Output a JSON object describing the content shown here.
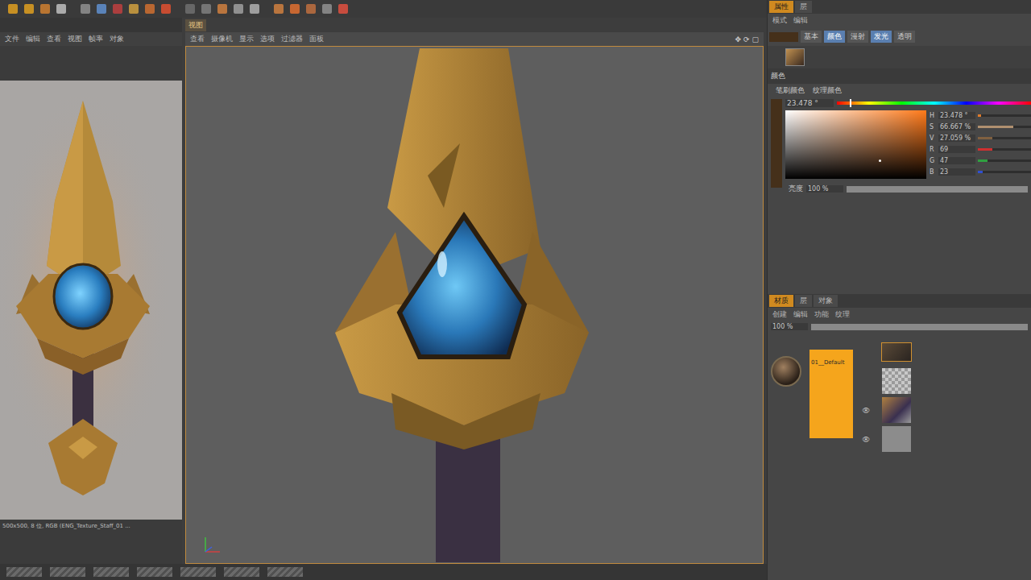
{
  "left_panel": {
    "menu": [
      "文件",
      "编辑",
      "查看",
      "视图",
      "帧率",
      "对象"
    ],
    "status": "500x500, 8 位, RGB (ENG_Texture_Staff_01 ..."
  },
  "viewport": {
    "tab": "视图",
    "menu": [
      "查看",
      "摄像机",
      "显示",
      "选项",
      "过滤器",
      "面板"
    ]
  },
  "attributes": {
    "tabs": [
      {
        "label": "属性",
        "selected": true
      },
      {
        "label": "层",
        "selected": false
      }
    ],
    "mode_menu": [
      "模式",
      "编辑"
    ],
    "swatch": "#45301a",
    "channels": [
      {
        "label": "基本",
        "selected": false
      },
      {
        "label": "颜色",
        "selected": true
      },
      {
        "label": "漫射",
        "selected": false
      },
      {
        "label": "发光",
        "selected": true
      },
      {
        "label": "透明",
        "selected": false
      }
    ],
    "section": "颜色",
    "options": [
      "笔刷颜色",
      "纹理颜色"
    ],
    "hue": {
      "reading": "23.478 °",
      "level": 0.065
    },
    "picker": {
      "s": 0.667,
      "v": 0.271
    },
    "fields": [
      {
        "label": "H",
        "reading": "23.478 °",
        "level": 0.065,
        "color": "#e07b2a"
      },
      {
        "label": "S",
        "reading": "66.667 %",
        "level": 0.667,
        "color": "#b09070"
      },
      {
        "label": "V",
        "reading": "27.059 %",
        "level": 0.271,
        "color": "#806040"
      },
      {
        "label": "R",
        "reading": "69",
        "level": 0.271,
        "color": "#d03030"
      },
      {
        "label": "G",
        "reading": "47",
        "level": 0.184,
        "color": "#30a040"
      },
      {
        "label": "B",
        "reading": "23",
        "level": 0.09,
        "color": "#3050d0"
      }
    ],
    "brightness": {
      "label": "亮度",
      "reading": "100 %",
      "level": 1
    }
  },
  "layers": {
    "tabs": [
      {
        "label": "材质",
        "selected": true
      },
      {
        "label": "层",
        "selected": false
      },
      {
        "label": "对象",
        "selected": false
      }
    ],
    "menu": [
      "创建",
      "编辑",
      "功能",
      "纹理"
    ],
    "opacity": {
      "reading": "100 %",
      "level": 1
    },
    "material": "01__Default",
    "items": [
      {
        "kind": "image",
        "visible": false,
        "selected": true
      },
      {
        "kind": "transparent",
        "visible": false,
        "selected": false
      },
      {
        "kind": "paint",
        "visible": true,
        "selected": false
      },
      {
        "kind": "fill",
        "visible": true,
        "selected": false
      }
    ]
  }
}
